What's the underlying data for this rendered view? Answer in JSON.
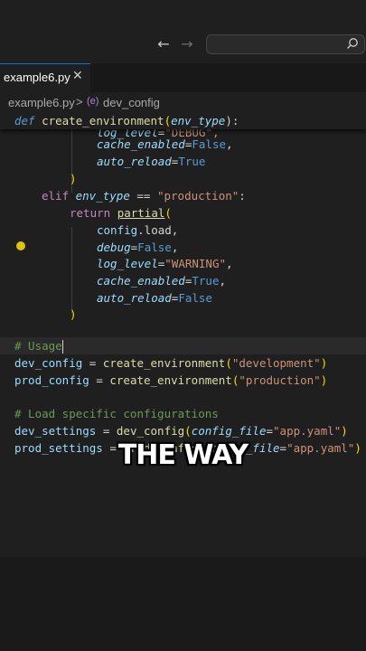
{
  "toolbar": {
    "back_icon": "arrow-left-icon",
    "back_glyph": "←",
    "forward_icon": "arrow-right-icon",
    "forward_glyph": "→",
    "search_placeholder": ""
  },
  "tab": {
    "label": "example6.py",
    "close_glyph": "✕"
  },
  "breadcrumb": {
    "file": "example6.py",
    "separator": ">",
    "symbol_icon": "(e)",
    "symbol": "dev_config"
  },
  "code": {
    "sticky": {
      "kw": "def",
      "fn": "create_environment",
      "open": "(",
      "param": "env_type",
      "close": "):"
    },
    "l1": {
      "a": "log_level",
      "b": "=",
      "c": "\"DEBUG\","
    },
    "l2": {
      "a": "cache_enabled",
      "b": "=",
      "c": "False",
      "d": ","
    },
    "l3": {
      "a": "auto_reload",
      "b": "=",
      "c": "True"
    },
    "l4": {
      "a": ")"
    },
    "l5": {
      "a": "elif",
      "b": " env_type ",
      "c": "==",
      "d": " ",
      "e": "\"production\"",
      "f": ":"
    },
    "l6": {
      "a": "return",
      "b": " ",
      "c": "partial",
      "d": "("
    },
    "l7": {
      "a": "config",
      "b": ".load,"
    },
    "l8": {
      "a": "debug",
      "b": "=",
      "c": "False",
      "d": ","
    },
    "l9": {
      "a": "log_level",
      "b": "=",
      "c": "\"WARNING\"",
      "d": ","
    },
    "l10": {
      "a": "cache_enabled",
      "b": "=",
      "c": "True",
      "d": ","
    },
    "l11": {
      "a": "auto_reload",
      "b": "=",
      "c": "False"
    },
    "l12": {
      "a": ")"
    },
    "l13": {
      "a": "# Usage"
    },
    "l14": {
      "a": "dev_config",
      "b": " = ",
      "c": "create_environment",
      "d": "(",
      "e": "\"development\"",
      "f": ")"
    },
    "l15": {
      "a": "prod_config",
      "b": " = ",
      "c": "create_environment",
      "d": "(",
      "e": "\"production\"",
      "f": ")"
    },
    "l16": {
      "a": "# Load specific configurations"
    },
    "l17": {
      "a": "dev_settings",
      "b": " = ",
      "c": "dev_config",
      "d": "(",
      "e": "config_file",
      "f": "=",
      "g": "\"app.yaml\"",
      "h": ")"
    },
    "l18": {
      "a": "prod_settings",
      "b": " = ",
      "c": "prod_config",
      "d": "(",
      "e": "config_file",
      "f": "=",
      "g": "\"app.yaml\"",
      "h": ")"
    }
  },
  "caption": "THE WAY",
  "colors": {
    "accent": "#0078d4",
    "keyword": "#569cd6",
    "function": "#dcdcaa",
    "string": "#ce9178",
    "comment": "#6a9955",
    "control": "#c586c0"
  }
}
